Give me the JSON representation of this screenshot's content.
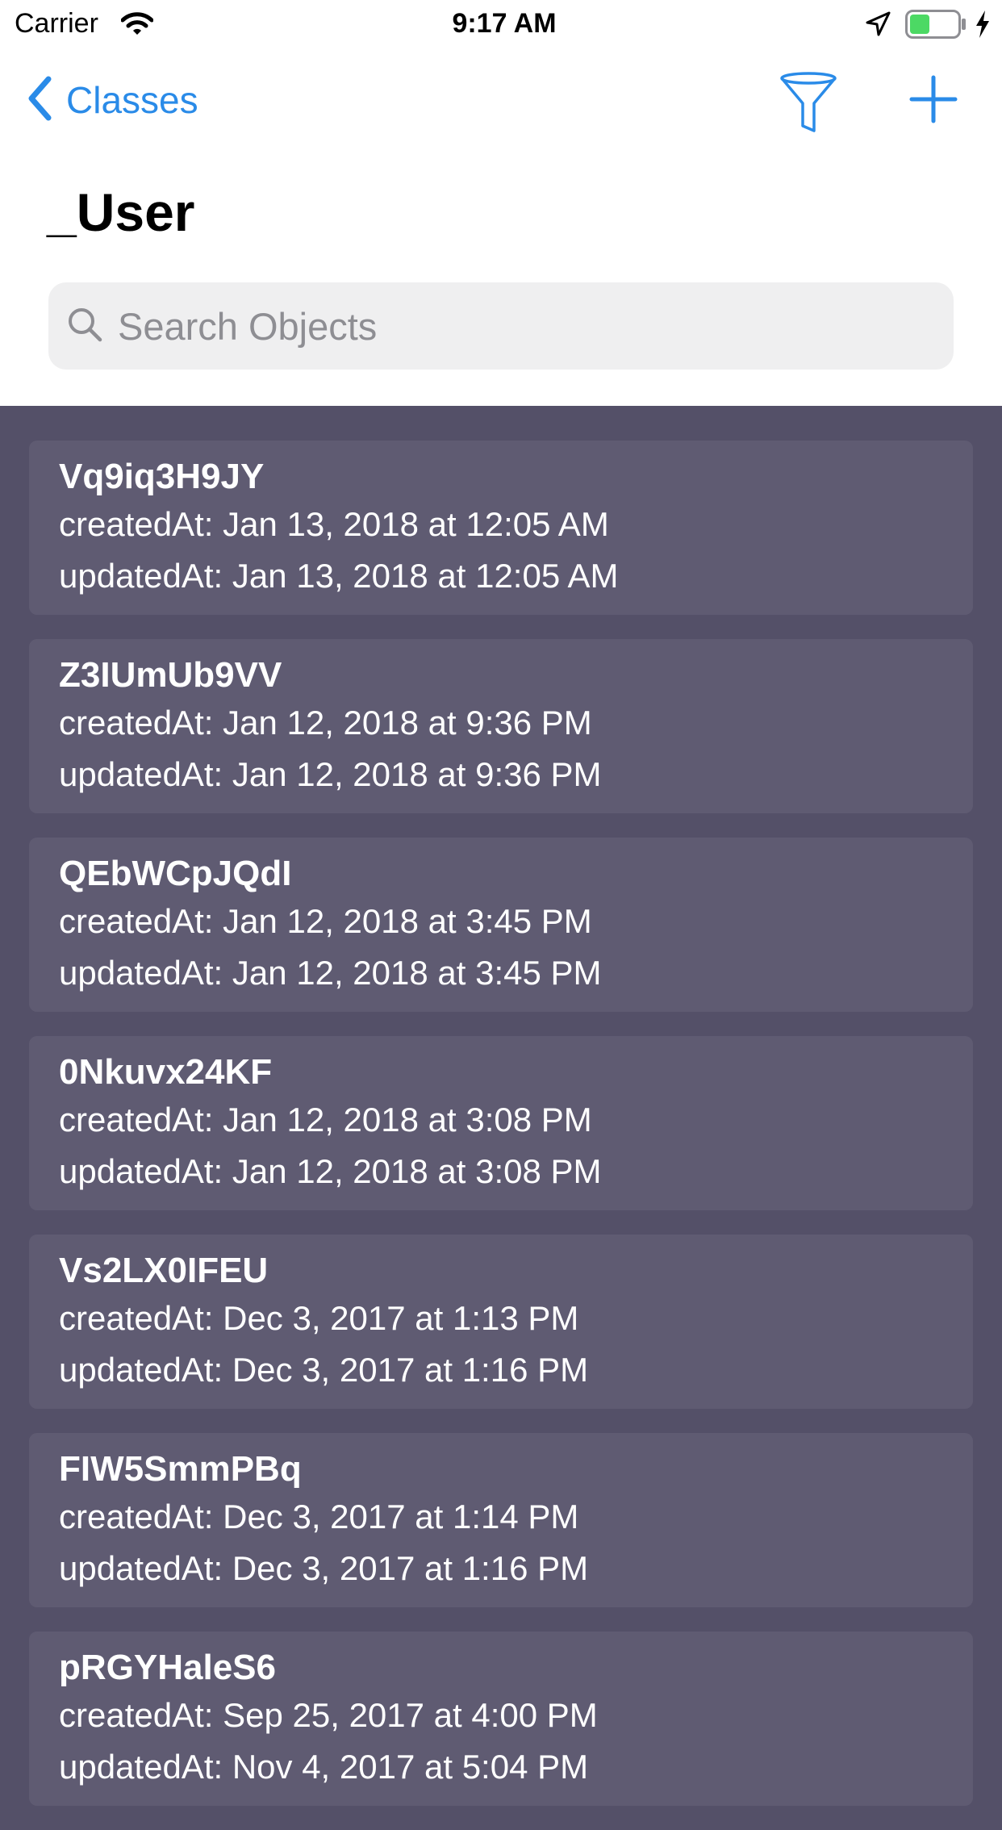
{
  "status_bar": {
    "carrier": "Carrier",
    "time": "9:17 AM",
    "battery_color": "#4cd964"
  },
  "nav": {
    "back_label": "Classes",
    "accent_color": "#2a8be8",
    "filter_icon": "filter-icon",
    "add_icon": "plus-icon"
  },
  "page": {
    "title": "_User"
  },
  "search": {
    "placeholder": "Search Objects",
    "value": ""
  },
  "objects": [
    {
      "id": "Vq9iq3H9JY",
      "created": "createdAt: Jan 13, 2018 at 12:05 AM",
      "updated": "updatedAt: Jan 13, 2018 at 12:05 AM"
    },
    {
      "id": "Z3IUmUb9VV",
      "created": "createdAt: Jan 12, 2018 at 9:36 PM",
      "updated": "updatedAt: Jan 12, 2018 at 9:36 PM"
    },
    {
      "id": "QEbWCpJQdI",
      "created": "createdAt: Jan 12, 2018 at 3:45 PM",
      "updated": "updatedAt: Jan 12, 2018 at 3:45 PM"
    },
    {
      "id": "0Nkuvx24KF",
      "created": "createdAt: Jan 12, 2018 at 3:08 PM",
      "updated": "updatedAt: Jan 12, 2018 at 3:08 PM"
    },
    {
      "id": "Vs2LX0IFEU",
      "created": "createdAt: Dec 3, 2017 at 1:13 PM",
      "updated": "updatedAt: Dec 3, 2017 at 1:16 PM"
    },
    {
      "id": "FIW5SmmPBq",
      "created": "createdAt: Dec 3, 2017 at 1:14 PM",
      "updated": "updatedAt: Dec 3, 2017 at 1:16 PM"
    },
    {
      "id": "pRGYHaleS6",
      "created": "createdAt: Sep 25, 2017 at 4:00 PM",
      "updated": "updatedAt: Nov 4, 2017 at 5:04 PM"
    }
  ]
}
